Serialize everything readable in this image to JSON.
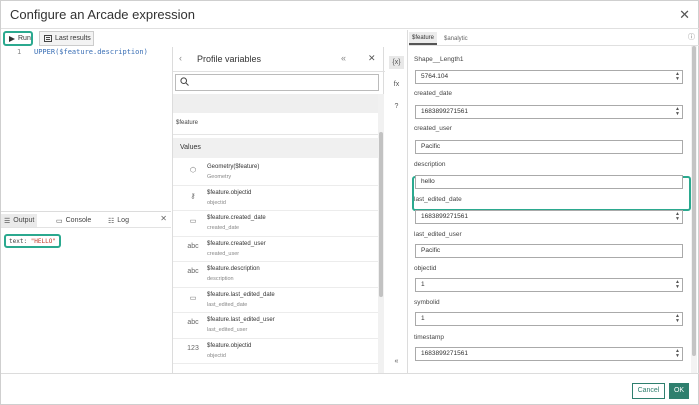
{
  "dialog": {
    "title": "Configure an Arcade expression",
    "close": "✕"
  },
  "toolbar": {
    "run_label": "Run",
    "last_results_label": "Last results"
  },
  "editor": {
    "line_number": "1",
    "code": "UPPER($feature.description)"
  },
  "output": {
    "tabs": [
      "Output",
      "Console",
      "Log"
    ],
    "close": "✕",
    "result_prefix": "text: ",
    "result_value": "\"HELLO\""
  },
  "profile": {
    "title": "Profile variables",
    "back": "‹",
    "collapse": "«",
    "close": "✕",
    "search_placeholder": "",
    "feature_label": "$feature",
    "values_header": "Values",
    "items": [
      {
        "icon": "geometry-icon",
        "glyph": "⬡",
        "name": "Geometry($feature)",
        "sub": "Geometry"
      },
      {
        "icon": "key-icon",
        "glyph": "⚷",
        "name": "$feature.objectid",
        "sub": "objectid"
      },
      {
        "icon": "calendar-icon",
        "glyph": "▭",
        "name": "$feature.created_date",
        "sub": "created_date"
      },
      {
        "icon": "text-icon",
        "glyph": "abc",
        "name": "$feature.created_user",
        "sub": "created_user"
      },
      {
        "icon": "text-icon",
        "glyph": "abc",
        "name": "$feature.description",
        "sub": "description"
      },
      {
        "icon": "calendar-icon",
        "glyph": "▭",
        "name": "$feature.last_edited_date",
        "sub": "last_edited_date"
      },
      {
        "icon": "text-icon",
        "glyph": "abc",
        "name": "$feature.last_edited_user",
        "sub": "last_edited_user"
      },
      {
        "icon": "number-icon",
        "glyph": "123",
        "name": "$feature.objectid",
        "sub": "objectid"
      }
    ]
  },
  "sidebar": {
    "variables": "{x}",
    "functions": "fx",
    "help": "?",
    "expand": "«"
  },
  "test_data": {
    "tabs": [
      "$feature",
      "$analytic"
    ],
    "info": "ⓘ",
    "fields": [
      {
        "label": "Shape__Length1",
        "value": "5764.104",
        "spinner": true
      },
      {
        "label": "created_date",
        "value": "1683899271561",
        "spinner": true
      },
      {
        "label": "created_user",
        "value": "Pacific",
        "spinner": false
      },
      {
        "label": "description",
        "value": "hello",
        "spinner": false
      },
      {
        "label": "last_edited_date",
        "value": "1683899271561",
        "spinner": true
      },
      {
        "label": "last_edited_user",
        "value": "Pacific",
        "spinner": false
      },
      {
        "label": "objectid",
        "value": "1",
        "spinner": true
      },
      {
        "label": "symbolid",
        "value": "1",
        "spinner": true
      },
      {
        "label": "timestamp",
        "value": "1683899271561",
        "spinner": true
      }
    ]
  },
  "footer": {
    "cancel_label": "Cancel",
    "ok_label": "OK"
  },
  "colors": {
    "accent": "#2ba98f",
    "primary_button": "#2e7f6e"
  }
}
